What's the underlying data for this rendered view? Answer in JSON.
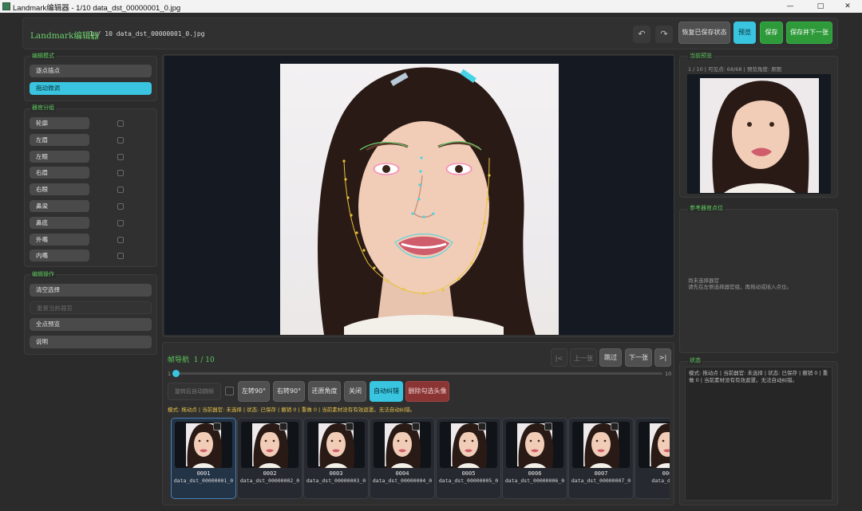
{
  "window": {
    "title": "Landmark编辑器 - 1/10  data_dst_00000001_0.jpg",
    "minimize": "—",
    "maximize": "□",
    "close": "✕"
  },
  "header": {
    "app_name": "Landmark编辑器",
    "info": "1 / 10  data_dst_00000001_0.jpg",
    "undo_glyph": "↶",
    "redo_glyph": "↷",
    "restore_label": "恢复已保存状态",
    "preview_label": "预览",
    "save_label": "保存",
    "save_next_label": "保存并下一张"
  },
  "edit_mode": {
    "title": "编辑模式",
    "items": [
      "逐点插点",
      "拖动微调"
    ],
    "active_index": 1
  },
  "organ_group": {
    "title": "器官分组",
    "items": [
      "轮廓",
      "左眉",
      "左眼",
      "右眉",
      "右眼",
      "鼻梁",
      "鼻底",
      "外嘴",
      "内嘴"
    ]
  },
  "edit_ops": {
    "title": "编辑操作",
    "clear_label": "清空选择",
    "reset_label": "重置当前器官",
    "full_preview_label": "全点预览",
    "help_label": "说明"
  },
  "preview_panel": {
    "title": "当前预览",
    "info": "1 / 10  | 可见点: 68/68  | 预览角度: 原图"
  },
  "ref_panel": {
    "title": "参考器官点位",
    "line1": "尚未选择器官",
    "line2": "请先在左侧选择器官组，再拖动或插入点位。"
  },
  "status_panel": {
    "title": "状态",
    "text": "模式: 拖动点  | 当前器官: 未选择  | 状态: 已保存  | 撤销 0  | 重做 0  | 当前素材没有有效遮罩。无法自动纠错。"
  },
  "nav": {
    "title": "帧导航",
    "position": "1 / 10",
    "first_label": "|<",
    "prev_label": "上一张",
    "skip_label": "跳过",
    "next_label": "下一张",
    "last_label": ">|",
    "slider_min": "1",
    "slider_max": "10",
    "slider_value": 1,
    "auto_jump_label": "旋转后自动跳帧",
    "rotate_left_label": "左转90°",
    "rotate_right_label": "右转90°",
    "reset_angle_label": "还原角度",
    "close_label": "关闭",
    "auto_fix_label": "自动纠错",
    "delete_label": "删除勾选头像",
    "status_line": "模式: 拖动点  | 当前器官: 未选择  | 状态: 已保存  | 撤销 0  | 重做 0  | 当前素材没有有效遮罩。无法自动纠错。"
  },
  "thumbnails": [
    {
      "num": "0001",
      "name": "data_dst_00000001_0"
    },
    {
      "num": "0002",
      "name": "data_dst_00000002_0"
    },
    {
      "num": "0003",
      "name": "data_dst_00000003_0"
    },
    {
      "num": "0004",
      "name": "data_dst_00000004_0"
    },
    {
      "num": "0005",
      "name": "data_dst_00000005_0"
    },
    {
      "num": "0006",
      "name": "data_dst_00000006_0"
    },
    {
      "num": "0007",
      "name": "data_dst_00000007_0"
    },
    {
      "num": "000",
      "name": "data_dst_0"
    }
  ],
  "colors": {
    "accent_cyan": "#39c5e0",
    "green": "#2e9a3a",
    "title_green": "#5dc85d",
    "danger": "#8a3434",
    "landmark_yellow": "#e8c53a",
    "landmark_green": "#6cd06c",
    "landmark_cyan": "#45d4e6",
    "landmark_pink": "#ff66cc"
  }
}
